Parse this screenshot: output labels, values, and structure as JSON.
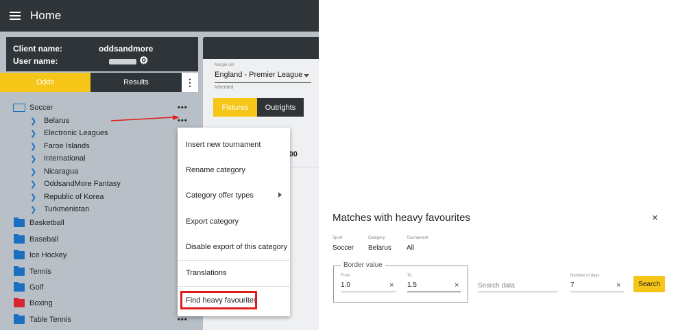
{
  "header": {
    "title": "Home"
  },
  "client": {
    "client_label": "Client name:",
    "client_value": "oddsandmore",
    "user_label": "User name:"
  },
  "tabs": {
    "odds": "Odds",
    "results": "Results"
  },
  "tree": {
    "soccer": "Soccer",
    "categories": [
      "Belarus",
      "Electronic Leagues",
      "Faroe Islands",
      "International",
      "Nicaragua",
      "OddsandMore Fantasy",
      "Republic of Korea",
      "Turkmenistan"
    ],
    "sports": [
      {
        "label": "Basketball",
        "color": "#1a6fc1"
      },
      {
        "label": "Baseball",
        "color": "#1a6fc1"
      },
      {
        "label": "Ice Hockey",
        "color": "#1a6fc1"
      },
      {
        "label": "Tennis",
        "color": "#1a6fc1"
      },
      {
        "label": "Golf",
        "color": "#1a6fc1"
      },
      {
        "label": "Boxing",
        "color": "#d9262e"
      },
      {
        "label": "Table Tennis",
        "color": "#1a6fc1"
      }
    ],
    "more_icon": "•••"
  },
  "middle": {
    "margin_set_label": "Margin set",
    "margin_set_value": "England - Premier League",
    "inherited": "Inherited",
    "fixtures": "Fixtures",
    "outrights": "Outrights",
    "time_fragment": ":00"
  },
  "context_menu": {
    "items": [
      "Insert new tournament",
      "Rename category",
      "Category offer types",
      "Export category",
      "Disable export of this category",
      "Translations",
      "Find heavy favourites"
    ]
  },
  "dialog": {
    "title": "Matches with heavy favourites",
    "close": "×",
    "sport_label": "Sport",
    "sport_value": "Soccer",
    "category_label": "Category",
    "category_value": "Belarus",
    "tournament_label": "Tournament",
    "tournament_value": "All",
    "border_value_legend": "Border value",
    "from_label": "From",
    "from_value": "1.0",
    "to_label": "To",
    "to_value": "1.5",
    "search_placeholder": "Search data",
    "days_label": "Number of days",
    "days_value": "7",
    "search_button": "Search",
    "clear": "×"
  },
  "colors": {
    "accent": "#f5c518",
    "dark": "#2f3438",
    "highlight": "#e01b1b",
    "folder_blue": "#1a6fc1"
  }
}
